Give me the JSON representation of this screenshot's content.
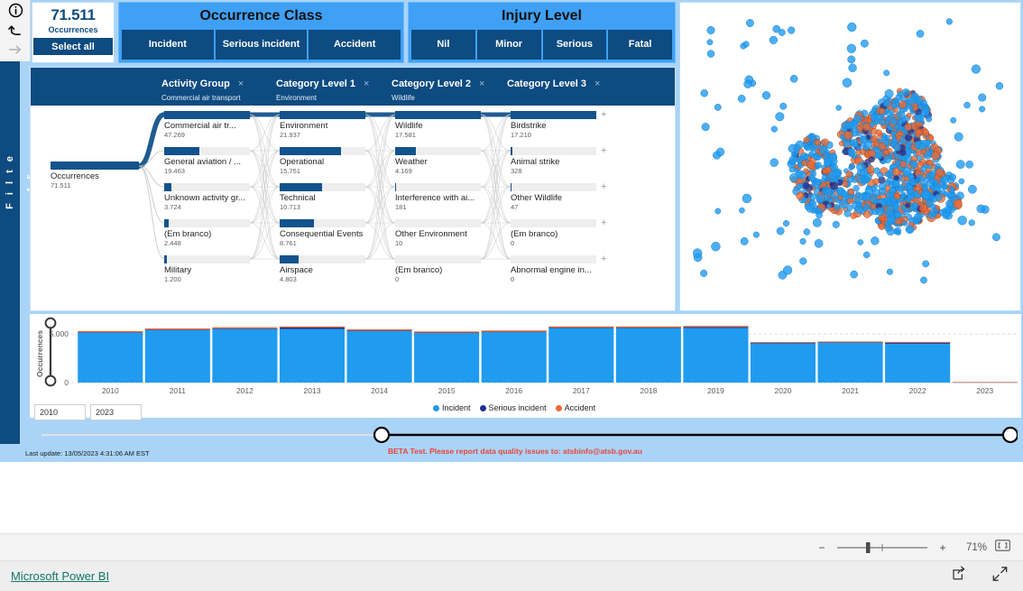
{
  "left_rail": {
    "filters_label": "F i l t e r s",
    "icons": [
      "info-icon",
      "undo-icon",
      "forward-arrow-icon"
    ]
  },
  "kpi": {
    "value": "71.511",
    "label": "Occurrences",
    "select_all": "Select all"
  },
  "slicers": [
    {
      "id": "occurrence-class",
      "title": "Occurrence Class",
      "options": [
        "Incident",
        "Serious incident",
        "Accident"
      ]
    },
    {
      "id": "injury-level",
      "title": "Injury Level",
      "options": [
        "Nil",
        "Minor",
        "Serious",
        "Fatal"
      ]
    }
  ],
  "sankey": {
    "columns": [
      {
        "title": "Activity Group",
        "subtitle": "Commercial air transport",
        "close": "×"
      },
      {
        "title": "Category Level 1",
        "subtitle": "Environment",
        "close": "×"
      },
      {
        "title": "Category Level 2",
        "subtitle": "Wildlife",
        "close": "×"
      },
      {
        "title": "Category Level 3",
        "subtitle": "",
        "close": "×"
      }
    ],
    "root": {
      "name": "Occurrences",
      "value": "71.511"
    },
    "col1": [
      {
        "name": "Commercial air tr...",
        "value": "47.269",
        "pct": 100
      },
      {
        "name": "General aviation / ...",
        "value": "19.463",
        "pct": 41
      },
      {
        "name": "Unknown activity gr...",
        "value": "3.724",
        "pct": 8
      },
      {
        "name": "(Em branco)",
        "value": "2.448",
        "pct": 5
      },
      {
        "name": "Military",
        "value": "1.200",
        "pct": 3
      }
    ],
    "col2": [
      {
        "name": "Environment",
        "value": "21.937",
        "pct": 100
      },
      {
        "name": "Operational",
        "value": "15.751",
        "pct": 72
      },
      {
        "name": "Technical",
        "value": "10.713",
        "pct": 49
      },
      {
        "name": "Consequential Events",
        "value": "8.761",
        "pct": 40
      },
      {
        "name": "Airspace",
        "value": "4.803",
        "pct": 22
      }
    ],
    "col3": [
      {
        "name": "Wildlife",
        "value": "17.581",
        "pct": 100
      },
      {
        "name": "Weather",
        "value": "4.169",
        "pct": 24
      },
      {
        "name": "Interference with ai...",
        "value": "181",
        "pct": 1
      },
      {
        "name": "Other Environment",
        "value": "10",
        "pct": 0
      },
      {
        "name": "(Em branco)",
        "value": "0",
        "pct": 0
      }
    ],
    "col4": [
      {
        "name": "Birdstrike",
        "value": "17.210",
        "pct": 100
      },
      {
        "name": "Animal strike",
        "value": "328",
        "pct": 2
      },
      {
        "name": "Other Wildlife",
        "value": "47",
        "pct": 1
      },
      {
        "name": "(Em branco)",
        "value": "0",
        "pct": 0
      },
      {
        "name": "Abnormal engine in...",
        "value": "0",
        "pct": 0
      }
    ],
    "expand_glyph": "+"
  },
  "chart_data": {
    "type": "bar",
    "title": "",
    "xlabel": "",
    "ylabel": "Occurrences",
    "ylim": [
      0,
      6500
    ],
    "yticks": [
      "0",
      "5.000"
    ],
    "grid": true,
    "legend_position": "bottom-right",
    "categories": [
      "2010",
      "2011",
      "2012",
      "2013",
      "2014",
      "2015",
      "2016",
      "2017",
      "2018",
      "2019",
      "2020",
      "2021",
      "2022",
      "2023"
    ],
    "series": [
      {
        "name": "Incident",
        "color": "#1f9bf0",
        "values": [
          5130,
          5390,
          5520,
          5500,
          5290,
          5090,
          5180,
          5610,
          5610,
          5610,
          4070,
          4120,
          4000,
          40
        ]
      },
      {
        "name": "Serious incident",
        "color": "#1f2f8f",
        "values": [
          60,
          60,
          60,
          170,
          70,
          60,
          60,
          50,
          50,
          110,
          30,
          30,
          110,
          5
        ]
      },
      {
        "name": "Accident",
        "color": "#ec6a33",
        "values": [
          110,
          120,
          120,
          110,
          120,
          110,
          120,
          120,
          120,
          110,
          80,
          80,
          80,
          15
        ]
      }
    ]
  },
  "year_range": {
    "from": "2010",
    "to": "2023"
  },
  "footer": {
    "beta_note": "BETA Test. Please report data quality issues to: atsbinfo@atsb.gov.au",
    "last_update": "Last update: 13/05/2023 4:31:06 AM EST"
  },
  "chrome": {
    "zoom_percent": "71%",
    "zoom_out": "−",
    "zoom_in": "+",
    "powerbi_link": "Microsoft Power BI"
  },
  "colors": {
    "brand_dark": "#0d4b80",
    "brand_light": "#3fa0f5",
    "canvas": "#a9d4f8",
    "node_bar": "#13538c",
    "accident": "#ec6a33",
    "incident": "#1f9bf0",
    "serious": "#1f2f8f"
  }
}
